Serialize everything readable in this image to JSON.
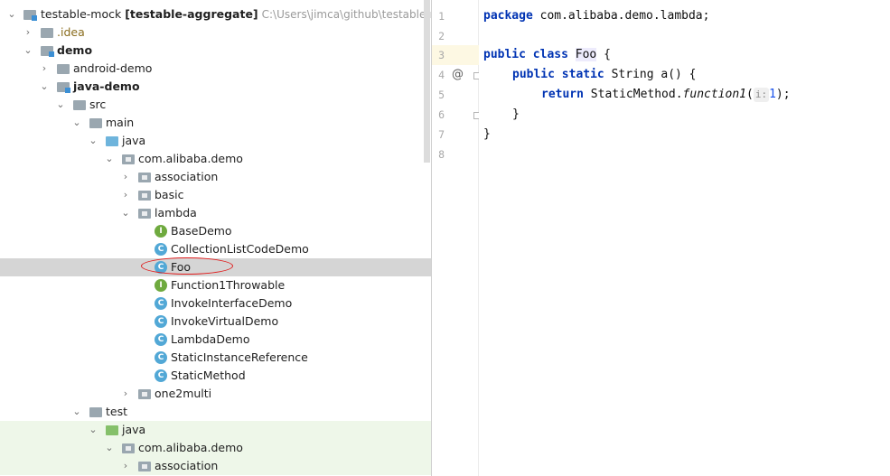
{
  "tree": {
    "root": {
      "name": "testable-mock",
      "module": "[testable-aggregate]",
      "path": "C:\\Users\\jimca\\github\\testable-mock"
    },
    "items": [
      {
        "label": "testable-mock [testable-aggregate]"
      },
      {
        "label": ".idea"
      },
      {
        "label": "demo"
      },
      {
        "label": "android-demo"
      },
      {
        "label": "java-demo"
      },
      {
        "label": "src"
      },
      {
        "label": "main"
      },
      {
        "label": "java"
      },
      {
        "label": "com.alibaba.demo"
      },
      {
        "label": "association"
      },
      {
        "label": "basic"
      },
      {
        "label": "lambda"
      },
      {
        "label": "BaseDemo"
      },
      {
        "label": "CollectionListCodeDemo"
      },
      {
        "label": "Foo"
      },
      {
        "label": "Function1Throwable"
      },
      {
        "label": "InvokeInterfaceDemo"
      },
      {
        "label": "InvokeVirtualDemo"
      },
      {
        "label": "LambdaDemo"
      },
      {
        "label": "StaticInstanceReference"
      },
      {
        "label": "StaticMethod"
      },
      {
        "label": "one2multi"
      },
      {
        "label": "test"
      },
      {
        "label": "java"
      },
      {
        "label": "com.alibaba.demo"
      },
      {
        "label": "association"
      }
    ],
    "selected": "Foo",
    "icons": {
      "class": "C",
      "interface": "I"
    }
  },
  "editor": {
    "line_numbers": [
      "1",
      "2",
      "3",
      "4",
      "5",
      "6",
      "7",
      "8"
    ],
    "lines": {
      "l1_kw": "package",
      "l1_rest": " com.alibaba.demo.lambda;",
      "l3_kw1": "public",
      "l3_kw2": "class",
      "l3_cls": "Foo",
      "l3_rest": " {",
      "l4_kw1": "public",
      "l4_kw2": "static",
      "l4_rest": " String a() {",
      "l5_kw": "return",
      "l5_call": " StaticMethod.",
      "l5_fn": "function1",
      "l5_open": "(",
      "l5_hint": "i:",
      "l5_num": "1",
      "l5_close": ");",
      "l6": "}",
      "l7": "}"
    },
    "override_icon": "@",
    "colors": {
      "keyword": "#0033b3",
      "current_line": "#fdf8e3",
      "selection": "#d5d5d5",
      "annotation": "#e01a1a"
    }
  }
}
